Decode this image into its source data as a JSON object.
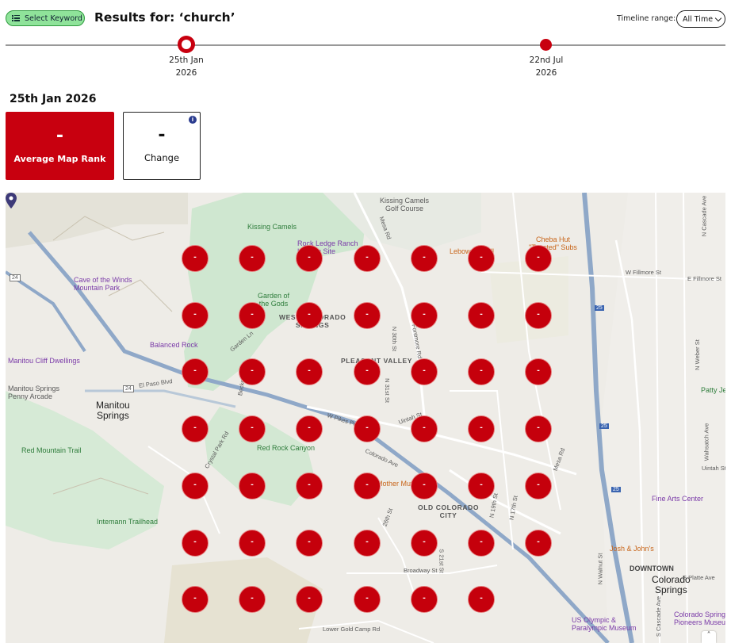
{
  "header": {
    "select_keyword_label": "Select Keyword",
    "title": "Results for: ‘church’",
    "timeline_range_label": "Timeline range:",
    "timeline_range_value": "All Time"
  },
  "timeline": {
    "points": [
      {
        "day": "25th Jan",
        "year": "2026",
        "selected": true
      },
      {
        "day": "22nd Jul",
        "year": "2026",
        "selected": false
      }
    ]
  },
  "selected_date": "25th Jan 2026",
  "stats": {
    "average_rank_value": "-",
    "average_rank_label": "Average Map Rank",
    "change_value": "-",
    "change_label": "Change",
    "info_icon": "info-icon"
  },
  "map": {
    "grid_rank": "-",
    "grid_rows": 7,
    "grid_cols": 7,
    "labels": {
      "kissing_camels_golf": "Kissing Camels\nGolf Course",
      "kissing_camels": "Kissing Camels",
      "rock_ledge": "Rock Ledge Ranch\nHistoric Site",
      "lebowski": "Lebowski Grill",
      "cheba": "Cheba Hut\n\"Toasted\" Subs",
      "cave_winds": "Cave of the Winds\nMountain Park",
      "garden_gods": "Garden of\nthe Gods",
      "west_colorado": "WEST COLORADO\nSPRINGS",
      "balanced_rock": "Balanced Rock",
      "pleasant_valley": "PLEASANT VALLEY",
      "manitou_cliff": "Manitou Cliff Dwellings",
      "manitou_arcade": "Manitou Springs\nPenny Arcade",
      "manitou_springs": "Manitou\nSprings",
      "red_mountain": "Red Mountain Trail",
      "red_rock": "Red Rock Canyon",
      "mother_muff": "Mother Muff",
      "intemann": "Intemann Trailhead",
      "old_colorado": "OLD COLORADO\nCITY",
      "fine_arts": "Fine Arts Center",
      "josh_johns": "Josh & John's",
      "downtown": "DOWNTOWN",
      "colorado_springs": "Colorado\nSprings",
      "us_olympic": "US Olympic &\nParalympic Museum",
      "pioneers": "Colorado Springs\nPioneers Museum",
      "patty_je": "Patty Je",
      "broadway": "Broadway St",
      "lower_gold": "Lower Gold Camp Rd",
      "el_paso": "El Paso Blvd",
      "e_fillmore": "E Fillmore St",
      "w_fillmore": "W Fillmore St",
      "e_platte": "E Platte Ave",
      "e_uintah": "Uintah St",
      "colorado_ave": "Colorado Ave",
      "w_pikes": "W Pikes Pe",
      "uintah_st": "Uintah St",
      "mesa_rd": "Mesa Rd",
      "n_30th": "N 30th St",
      "n_31st": "N 31st St",
      "fontmore": "Fontmore Rd",
      "n_19th": "N 19th St",
      "n_17th": "N 17th St",
      "n_cascade": "N Cascade Ave",
      "n_weber": "N Weber St",
      "wahsatch": "Wahsatch Ave",
      "s_21st": "S 21st St",
      "26th_st": "26th St",
      "mesa_rd2": "Mesa Rd",
      "crystal_park": "Crystal Park Rd",
      "garden_ln": "Garden Ln",
      "beckers_ln": "Beckers Ln",
      "walnut": "N Walnut St",
      "s_cascade": "S Cascade Ave",
      "rte24": "24",
      "rte24b": "24",
      "rte25": "25",
      "rte25b": "25",
      "rte25c": "25"
    }
  },
  "colors": {
    "brand_red": "#c8000f",
    "keyword_green": "#8fe39a",
    "info_blue": "#2b3c8f"
  }
}
